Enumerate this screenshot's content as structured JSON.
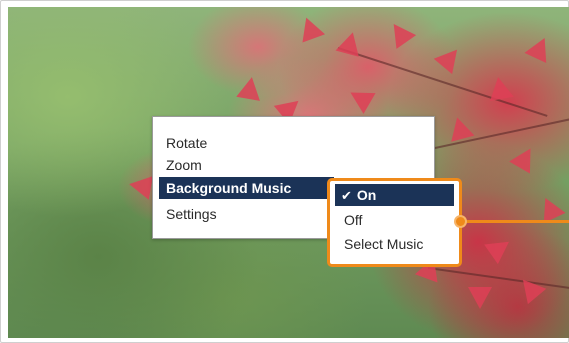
{
  "context_menu": {
    "items": [
      {
        "label": "Rotate",
        "selected": false
      },
      {
        "label": "Zoom",
        "selected": false
      },
      {
        "label": "Background Music",
        "selected": true
      },
      {
        "label": "Settings",
        "selected": false
      }
    ]
  },
  "submenu": {
    "items": [
      {
        "label": "On",
        "checked": true,
        "selected": true
      },
      {
        "label": "Off",
        "checked": false,
        "selected": false
      },
      {
        "label": "Select Music",
        "checked": false,
        "selected": false
      }
    ],
    "check_glyph": "✔"
  },
  "colors": {
    "highlight": "#1b3357",
    "callout": "#ef8a1a"
  }
}
